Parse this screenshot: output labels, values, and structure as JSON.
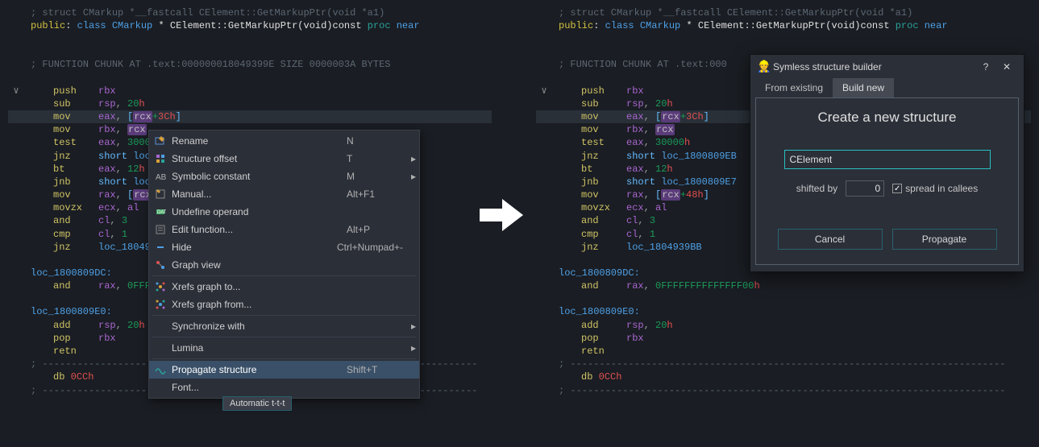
{
  "code": {
    "sig_comment": "; struct CMarkup *__fastcall CElement::GetMarkupPtr(void *a1)",
    "sig_pub": "public",
    "sig_colon": ":",
    "sig_class": " class ",
    "sig_type": "CMarkup",
    "sig_star": " * ",
    "sig_fn": "CElement::GetMarkupPtr(void)const",
    "sig_proc": " proc",
    "sig_near": " near",
    "chunk_comment": "; FUNCTION CHUNK AT .text:000000018049399E SIZE 0000003A BYTES",
    "chunk_comment_trunc": "; FUNCTION CHUNK AT .text:000",
    "lines": [
      {
        "mn": "push",
        "args": [
          {
            "t": "reg",
            "v": "rbx"
          }
        ]
      },
      {
        "mn": "sub",
        "args": [
          {
            "t": "reg",
            "v": "rsp"
          },
          {
            "t": "punc",
            "v": ", "
          },
          {
            "t": "green",
            "v": "20"
          },
          {
            "t": "num",
            "v": "h"
          }
        ]
      },
      {
        "mn": "mov",
        "args": [
          {
            "t": "reg",
            "v": "eax"
          },
          {
            "t": "punc",
            "v": ", "
          },
          {
            "t": "bracket",
            "v": "["
          },
          {
            "t": "hl",
            "v": "rcx"
          },
          {
            "t": "green",
            "v": "+"
          },
          {
            "t": "num",
            "v": "3C"
          },
          {
            "t": "num",
            "v": "h"
          },
          {
            "t": "bracket",
            "v": "]"
          }
        ]
      },
      {
        "mn": "mov",
        "args": [
          {
            "t": "reg",
            "v": "rbx"
          },
          {
            "t": "punc",
            "v": ", "
          },
          {
            "t": "hl",
            "v": "rcx"
          }
        ]
      },
      {
        "mn": "test",
        "args": [
          {
            "t": "reg",
            "v": "eax"
          },
          {
            "t": "punc",
            "v": ", "
          },
          {
            "t": "green",
            "v": "30000"
          },
          {
            "t": "num",
            "v": "h"
          }
        ]
      },
      {
        "mn": "jnz",
        "args": [
          {
            "t": "short",
            "v": "short "
          },
          {
            "t": "addr",
            "v": "loc_1800809EB"
          }
        ]
      },
      {
        "mn": "bt",
        "args": [
          {
            "t": "reg",
            "v": "eax"
          },
          {
            "t": "punc",
            "v": ", "
          },
          {
            "t": "green",
            "v": "12"
          },
          {
            "t": "num",
            "v": "h"
          }
        ]
      },
      {
        "mn": "jnb",
        "args": [
          {
            "t": "short",
            "v": "short "
          },
          {
            "t": "addr",
            "v": "loc_1800809E7"
          }
        ]
      },
      {
        "mn": "mov",
        "args": [
          {
            "t": "reg",
            "v": "rax"
          },
          {
            "t": "punc",
            "v": ", "
          },
          {
            "t": "bracket",
            "v": "["
          },
          {
            "t": "hl",
            "v": "rcx"
          },
          {
            "t": "green",
            "v": "+"
          },
          {
            "t": "num",
            "v": "48"
          },
          {
            "t": "num",
            "v": "h"
          },
          {
            "t": "bracket",
            "v": "]"
          }
        ]
      },
      {
        "mn": "movzx",
        "args": [
          {
            "t": "reg",
            "v": "ecx"
          },
          {
            "t": "punc",
            "v": ", "
          },
          {
            "t": "reg",
            "v": "al"
          }
        ]
      },
      {
        "mn": "and",
        "args": [
          {
            "t": "reg",
            "v": "cl"
          },
          {
            "t": "punc",
            "v": ", "
          },
          {
            "t": "green",
            "v": "3"
          }
        ]
      },
      {
        "mn": "cmp",
        "args": [
          {
            "t": "reg",
            "v": "cl"
          },
          {
            "t": "punc",
            "v": ", "
          },
          {
            "t": "green",
            "v": "1"
          }
        ]
      },
      {
        "mn": "jnz",
        "args": [
          {
            "t": "addr",
            "v": "loc_1804939BB"
          }
        ]
      }
    ],
    "label_dc": "loc_1800809DC:",
    "line_dc": {
      "mn": "and",
      "args": [
        {
          "t": "reg",
          "v": "rax"
        },
        {
          "t": "punc",
          "v": ", "
        },
        {
          "t": "green",
          "v": "0FFFFFFFFFFFFFF00"
        },
        {
          "t": "num",
          "v": "h"
        }
      ]
    },
    "line_dc_trunc": {
      "mn": "and",
      "args": [
        {
          "t": "reg",
          "v": "rax"
        },
        {
          "t": "punc",
          "v": ", "
        },
        {
          "t": "green",
          "v": "0FFF"
        }
      ]
    },
    "label_e0": "loc_1800809E0:",
    "lines_e0": [
      {
        "mn": "add",
        "args": [
          {
            "t": "reg",
            "v": "rsp"
          },
          {
            "t": "punc",
            "v": ", "
          },
          {
            "t": "green",
            "v": "20"
          },
          {
            "t": "num",
            "v": "h"
          }
        ]
      },
      {
        "mn": "pop",
        "args": [
          {
            "t": "reg",
            "v": "rbx"
          }
        ]
      },
      {
        "mn": "retn",
        "args": []
      }
    ],
    "dashes": "; ---------------------------------------------------------------------------",
    "db": "db",
    "db_val": " 0CCh",
    "short_labels": {
      "jnz": "loc",
      "jnb": "loc",
      "jnz2": "loc_18049"
    }
  },
  "menu": {
    "items": [
      {
        "icon": "rename",
        "label": "Rename",
        "shortcut": "N",
        "arrow": false
      },
      {
        "icon": "struct",
        "label": "Structure offset",
        "shortcut": "T",
        "arrow": true
      },
      {
        "icon": "symbolic",
        "label": "Symbolic constant",
        "shortcut": "M",
        "arrow": true
      },
      {
        "icon": "manual",
        "label": "Manual...",
        "shortcut": "Alt+F1",
        "arrow": false
      },
      {
        "icon": "undef",
        "label": "Undefine operand",
        "shortcut": "",
        "arrow": false
      },
      {
        "icon": "editfn",
        "label": "Edit function...",
        "shortcut": "Alt+P",
        "arrow": false
      },
      {
        "icon": "hide",
        "label": "Hide",
        "shortcut": "Ctrl+Numpad+-",
        "arrow": false
      },
      {
        "icon": "graph",
        "label": "Graph view",
        "shortcut": "",
        "arrow": false
      },
      {
        "icon": "xrefto",
        "label": "Xrefs graph to...",
        "shortcut": "",
        "arrow": false
      },
      {
        "icon": "xreffrom",
        "label": "Xrefs graph from...",
        "shortcut": "",
        "arrow": false
      },
      {
        "icon": "",
        "label": "Synchronize with",
        "shortcut": "",
        "arrow": true
      },
      {
        "icon": "",
        "label": "Lumina",
        "shortcut": "",
        "arrow": true
      },
      {
        "icon": "propagate",
        "label": "Propagate structure",
        "shortcut": "Shift+T",
        "arrow": false,
        "hl": true
      },
      {
        "icon": "",
        "label": "Font...",
        "shortcut": "",
        "arrow": false
      }
    ],
    "tooltip": "Automatic t-t-t"
  },
  "dialog": {
    "title": "Symless structure builder",
    "tabs": {
      "existing": "From existing",
      "buildnew": "Build new"
    },
    "heading": "Create a new structure",
    "input_value": "CElement",
    "shifted_label": "shifted by",
    "shifted_value": "0",
    "spread_label": "spread in callees",
    "spread_checked": true,
    "buttons": {
      "cancel": "Cancel",
      "propagate": "Propagate"
    }
  }
}
